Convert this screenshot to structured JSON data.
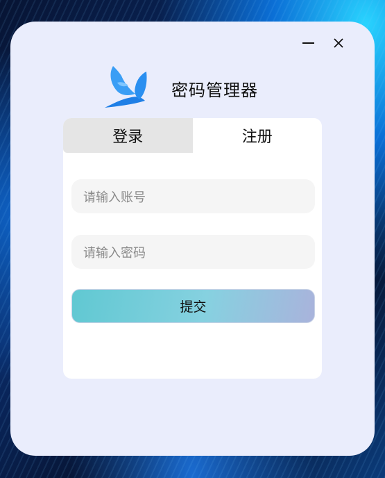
{
  "app": {
    "title": "密码管理器"
  },
  "window_controls": {
    "minimize_icon": "minimize-icon",
    "close_icon": "close-icon"
  },
  "logo": {
    "icon": "bird-logo-icon",
    "colors": [
      "#3a9ef5",
      "#1f7fe6"
    ]
  },
  "tabs": [
    {
      "label": "登录",
      "active": false
    },
    {
      "label": "注册",
      "active": true
    }
  ],
  "form": {
    "account": {
      "value": "",
      "placeholder": "请输入账号"
    },
    "password": {
      "value": "",
      "placeholder": "请输入密码"
    },
    "submit_label": "提交"
  },
  "colors": {
    "window_bg": "#eaedfc",
    "card_bg": "#ffffff",
    "inactive_tab_bg": "#e5e5e5",
    "field_bg": "#f5f5f5",
    "submit_gradient": [
      "#60c8d2",
      "#a9b3dc"
    ]
  }
}
